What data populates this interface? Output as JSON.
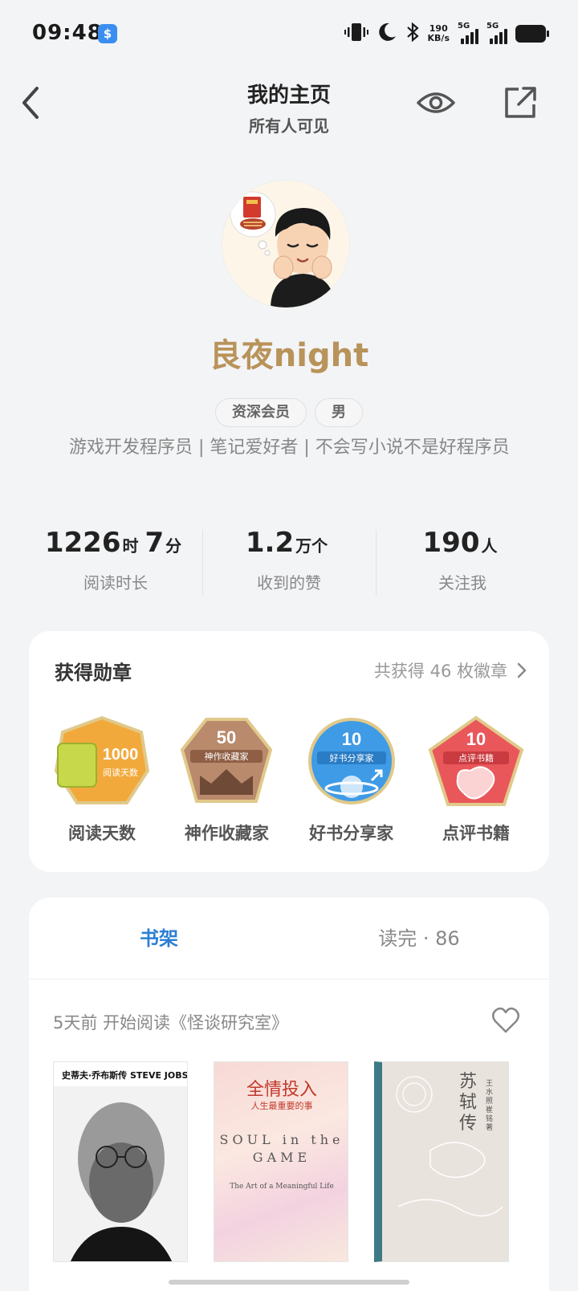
{
  "status_bar": {
    "time": "09:48",
    "app_icon_letter": "$",
    "net_speed_value": "190",
    "net_speed_unit": "KB/s",
    "sim1_label": "5G",
    "sim2_label": "5G",
    "icons": [
      "vibrate-icon",
      "moon-icon",
      "bluetooth-icon",
      "signal-icon",
      "battery-icon"
    ]
  },
  "header": {
    "title": "我的主页",
    "subtitle": "所有人可见",
    "icons": [
      "back-icon",
      "eye-icon",
      "share-icon"
    ]
  },
  "profile": {
    "username": "良夜night",
    "tags": [
      "资深会员",
      "男"
    ],
    "bio": "游戏开发程序员 | 笔记爱好者 | 不会写小说不是好程序员"
  },
  "stats": [
    {
      "value1": "1226",
      "unit1": "时",
      "value2": "7",
      "unit2": "分",
      "label": "阅读时长"
    },
    {
      "value1": "1.2",
      "unit1": "万个",
      "value2": "",
      "unit2": "",
      "label": "收到的赞"
    },
    {
      "value1": "190",
      "unit1": "人",
      "value2": "",
      "unit2": "",
      "label": "关注我"
    }
  ],
  "medals": {
    "title": "获得勋章",
    "summary": "共获得 46 枚徽章",
    "items": [
      {
        "name": "阅读天数",
        "number": "1000",
        "ribbon": "阅读天数",
        "color": "#f2a93b"
      },
      {
        "name": "神作收藏家",
        "number": "50",
        "ribbon": "神作收藏家",
        "color": "#b98a6c"
      },
      {
        "name": "好书分享家",
        "number": "10",
        "ribbon": "好书分享家",
        "color": "#3f9be6"
      },
      {
        "name": "点评书籍",
        "number": "10",
        "ribbon": "点评书籍",
        "color": "#e9575a"
      }
    ]
  },
  "shelf": {
    "tab_active": "书架",
    "tab_inactive": "读完 · 86",
    "activity": "5天前 开始阅读《怪谈研究室》",
    "books": [
      {
        "cover_title": "史蒂夫·乔布斯传 STEVE JOBS"
      },
      {
        "cover_title": "全情投入",
        "cover_sub": "人生最重要的事",
        "cover_en": "SOUL in the GAME",
        "cover_en2": "The Art of a Meaningful Life"
      },
      {
        "cover_title": "苏轼传",
        "cover_author": "王水照 崔铭 著"
      }
    ]
  }
}
